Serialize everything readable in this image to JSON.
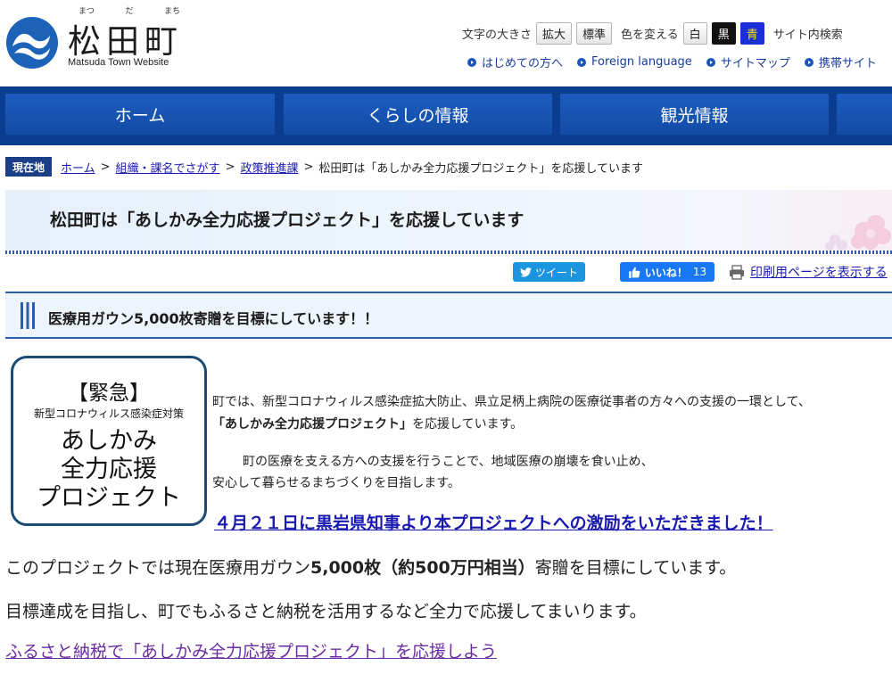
{
  "header": {
    "site_ruby": [
      "まつ",
      "だ",
      "まち"
    ],
    "site_name": "松田町",
    "site_subtitle": "Matsuda Town Website",
    "font_size_label": "文字の大きさ",
    "font_enlarge": "拡大",
    "font_standard": "標準",
    "color_label": "色を変える",
    "color_white": "白",
    "color_black": "黒",
    "color_blue": "青",
    "site_search_label": "サイト内検索",
    "links": [
      "はじめての方へ",
      "Foreign language",
      "サイトマップ",
      "携帯サイト"
    ],
    "colors": {
      "brand": "#0a3d8f",
      "logo": "#1c63b7"
    },
    "icons": [
      "town-emblem-logo",
      "circle-arrow-icon"
    ]
  },
  "nav": {
    "items": [
      "ホーム",
      "くらしの情報",
      "観光情報"
    ]
  },
  "breadcrumb": {
    "badge": "現在地",
    "home": "ホーム",
    "org": "組織・課名でさがす",
    "dept": "政策推進課",
    "current": "松田町は「あしかみ全力応援プロジェクト」を応援しています",
    "separator": ">"
  },
  "page": {
    "title": "松田町は「あしかみ全力応援プロジェクト」を応援しています"
  },
  "social": {
    "tweet": "ツイート",
    "like": "いいね！",
    "like_count": "13",
    "print": "印刷用ページを表示する",
    "icons": [
      "twitter-bird-icon",
      "thumbs-up-icon",
      "printer-icon"
    ]
  },
  "section": {
    "heading": "医療用ガウン5,000枚寄贈を目標にしています！！"
  },
  "emblem": {
    "line1": "【緊急】",
    "line2": "新型コロナウィルス感染症対策",
    "line3": "あしかみ",
    "line4": "全力応援",
    "line5": "プロジェクト"
  },
  "content": {
    "intro_line1": "町では、新型コロナウィルス感染症拡大防止、県立足柄上病院の医療従事者の方々への支援の一環として、",
    "intro_bold": "「あしかみ全力応援プロジェクト」",
    "intro_line2_rest": "を応援しています。",
    "para2_line1": "町の医療を支える方への支援を行うことで、地域医療の崩壊を食い止め、",
    "para2_line2": "安心して暮らせるまちづくりを目指します。",
    "news_link": "４月２１日に黒岩県知事より本プロジェクトへの激励をいただきました！",
    "body1_a": "このプロジェクトでは現在医療用ガウン",
    "body1_bold": "5,000枚（約500万円相当）",
    "body1_b": "寄贈を目標にしています。",
    "body2": "目標達成を目指し、町でもふるさと納税を活用するなど全力で応援してまいります。",
    "furusato_link": "ふるさと納税で「あしかみ全力応援プロジェクト」を応援しよう"
  }
}
